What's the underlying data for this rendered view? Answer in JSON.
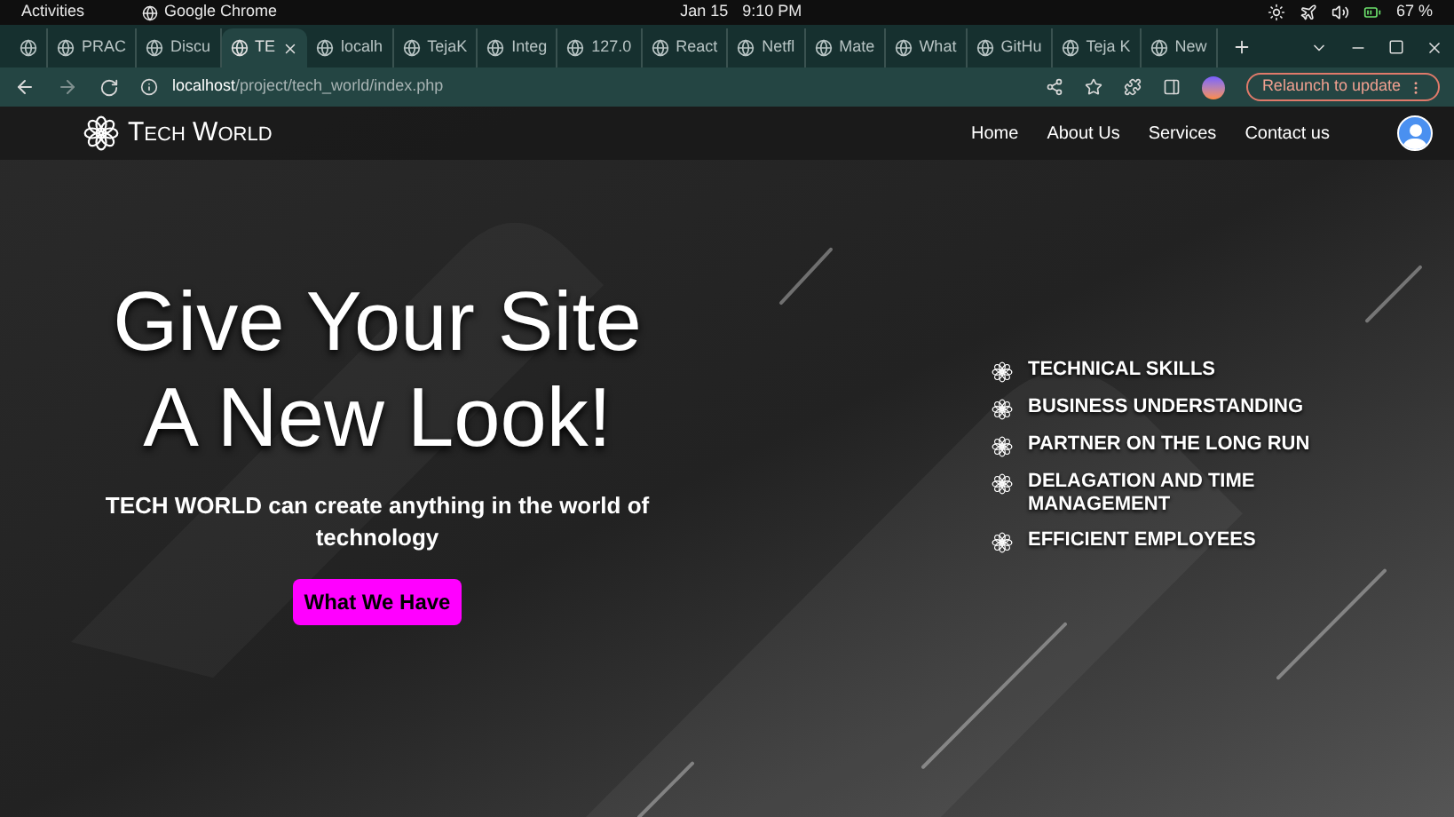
{
  "system_bar": {
    "activities": "Activities",
    "app": "Google Chrome",
    "date": "Jan 15",
    "time": "9:10 PM",
    "battery": "67 %"
  },
  "tabs": [
    {
      "selected": false
    },
    {
      "label": "PRAC",
      "selected": false
    },
    {
      "label": "Discu",
      "selected": false
    },
    {
      "label": "TE",
      "selected": true
    },
    {
      "label": "localh",
      "selected": false
    },
    {
      "label": "TejaK",
      "selected": false
    },
    {
      "label": "Integ",
      "selected": false
    },
    {
      "label": "127.0",
      "selected": false
    },
    {
      "label": "React",
      "selected": false
    },
    {
      "label": "Netfl",
      "selected": false
    },
    {
      "label": "Mate",
      "selected": false
    },
    {
      "label": "What",
      "selected": false
    },
    {
      "label": "GitHu",
      "selected": false
    },
    {
      "label": "Teja K",
      "selected": false
    },
    {
      "label": "New",
      "selected": false
    }
  ],
  "address_bar": {
    "host": "localhost",
    "path": "/project/tech_world/index.php",
    "relaunch": "Relaunch to update"
  },
  "site": {
    "logo": "Tech World",
    "nav": [
      "Home",
      "About Us",
      "Services",
      "Contact us"
    ],
    "hero": {
      "title_lines": [
        "Give Your Site",
        "A New Look!"
      ],
      "subtitle": "TECH WORLD can create anything in the world of technology",
      "button": "What We Have"
    },
    "features": [
      "TECHNICAL SKILLS",
      "BUSINESS UNDERSTANDING",
      "PARTNER ON THE LONG RUN",
      "DELAGATION AND TIME MANAGEMENT",
      "EFFICIENT EMPLOYEES"
    ]
  }
}
